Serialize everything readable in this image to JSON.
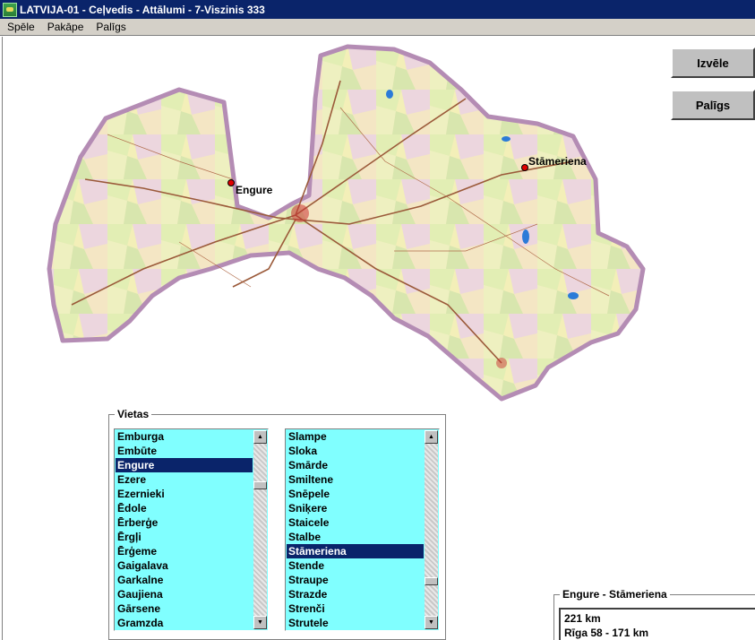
{
  "window": {
    "title": "LATVIJA-01 - Ceļvedis - Attālumi - 7-Viszinis 333"
  },
  "menu": [
    "Spēle",
    "Pakāpe",
    "Palīgs"
  ],
  "buttons": {
    "select": "Izvēle",
    "help": "Palīgs"
  },
  "map": {
    "markers": [
      {
        "label": "Engure"
      },
      {
        "label": "Stāmeriena"
      }
    ]
  },
  "places": {
    "group_label": "Vietas",
    "list1": {
      "items": [
        "Emburga",
        "Embūte",
        "Engure",
        "Ezere",
        "Ezernieki",
        "Ēdole",
        "Ērberģe",
        "Ērgļi",
        "Ērģeme",
        "Gaigalava",
        "Garkalne",
        "Gaujiena",
        "Gārsene",
        "Gramzda"
      ],
      "selected": "Engure"
    },
    "list2": {
      "items": [
        "Slampe",
        "Sloka",
        "Smārde",
        "Smiltene",
        "Snēpele",
        "Sniķere",
        "Staicele",
        "Stalbe",
        "Stāmeriena",
        "Stende",
        "Straupe",
        "Strazde",
        "Strenči",
        "Strutele"
      ],
      "selected": "Stāmeriena"
    }
  },
  "result": {
    "label": "Engure - Stāmeriena",
    "lines": [
      "221 km",
      "Rīga 58 - 171 km"
    ]
  },
  "colors": {
    "titlebar": "#0a246a",
    "list_bg": "#80ffff",
    "selection": "#0a246a",
    "marker": "#e00000"
  }
}
